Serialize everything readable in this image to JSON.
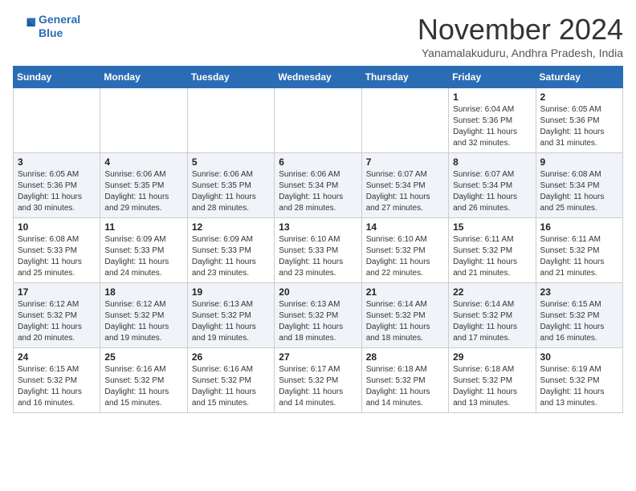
{
  "header": {
    "logo_line1": "General",
    "logo_line2": "Blue",
    "month_title": "November 2024",
    "location": "Yanamalakuduru, Andhra Pradesh, India"
  },
  "weekdays": [
    "Sunday",
    "Monday",
    "Tuesday",
    "Wednesday",
    "Thursday",
    "Friday",
    "Saturday"
  ],
  "weeks": [
    [
      {
        "day": "",
        "info": ""
      },
      {
        "day": "",
        "info": ""
      },
      {
        "day": "",
        "info": ""
      },
      {
        "day": "",
        "info": ""
      },
      {
        "day": "",
        "info": ""
      },
      {
        "day": "1",
        "info": "Sunrise: 6:04 AM\nSunset: 5:36 PM\nDaylight: 11 hours and 32 minutes."
      },
      {
        "day": "2",
        "info": "Sunrise: 6:05 AM\nSunset: 5:36 PM\nDaylight: 11 hours and 31 minutes."
      }
    ],
    [
      {
        "day": "3",
        "info": "Sunrise: 6:05 AM\nSunset: 5:36 PM\nDaylight: 11 hours and 30 minutes."
      },
      {
        "day": "4",
        "info": "Sunrise: 6:06 AM\nSunset: 5:35 PM\nDaylight: 11 hours and 29 minutes."
      },
      {
        "day": "5",
        "info": "Sunrise: 6:06 AM\nSunset: 5:35 PM\nDaylight: 11 hours and 28 minutes."
      },
      {
        "day": "6",
        "info": "Sunrise: 6:06 AM\nSunset: 5:34 PM\nDaylight: 11 hours and 28 minutes."
      },
      {
        "day": "7",
        "info": "Sunrise: 6:07 AM\nSunset: 5:34 PM\nDaylight: 11 hours and 27 minutes."
      },
      {
        "day": "8",
        "info": "Sunrise: 6:07 AM\nSunset: 5:34 PM\nDaylight: 11 hours and 26 minutes."
      },
      {
        "day": "9",
        "info": "Sunrise: 6:08 AM\nSunset: 5:34 PM\nDaylight: 11 hours and 25 minutes."
      }
    ],
    [
      {
        "day": "10",
        "info": "Sunrise: 6:08 AM\nSunset: 5:33 PM\nDaylight: 11 hours and 25 minutes."
      },
      {
        "day": "11",
        "info": "Sunrise: 6:09 AM\nSunset: 5:33 PM\nDaylight: 11 hours and 24 minutes."
      },
      {
        "day": "12",
        "info": "Sunrise: 6:09 AM\nSunset: 5:33 PM\nDaylight: 11 hours and 23 minutes."
      },
      {
        "day": "13",
        "info": "Sunrise: 6:10 AM\nSunset: 5:33 PM\nDaylight: 11 hours and 23 minutes."
      },
      {
        "day": "14",
        "info": "Sunrise: 6:10 AM\nSunset: 5:32 PM\nDaylight: 11 hours and 22 minutes."
      },
      {
        "day": "15",
        "info": "Sunrise: 6:11 AM\nSunset: 5:32 PM\nDaylight: 11 hours and 21 minutes."
      },
      {
        "day": "16",
        "info": "Sunrise: 6:11 AM\nSunset: 5:32 PM\nDaylight: 11 hours and 21 minutes."
      }
    ],
    [
      {
        "day": "17",
        "info": "Sunrise: 6:12 AM\nSunset: 5:32 PM\nDaylight: 11 hours and 20 minutes."
      },
      {
        "day": "18",
        "info": "Sunrise: 6:12 AM\nSunset: 5:32 PM\nDaylight: 11 hours and 19 minutes."
      },
      {
        "day": "19",
        "info": "Sunrise: 6:13 AM\nSunset: 5:32 PM\nDaylight: 11 hours and 19 minutes."
      },
      {
        "day": "20",
        "info": "Sunrise: 6:13 AM\nSunset: 5:32 PM\nDaylight: 11 hours and 18 minutes."
      },
      {
        "day": "21",
        "info": "Sunrise: 6:14 AM\nSunset: 5:32 PM\nDaylight: 11 hours and 18 minutes."
      },
      {
        "day": "22",
        "info": "Sunrise: 6:14 AM\nSunset: 5:32 PM\nDaylight: 11 hours and 17 minutes."
      },
      {
        "day": "23",
        "info": "Sunrise: 6:15 AM\nSunset: 5:32 PM\nDaylight: 11 hours and 16 minutes."
      }
    ],
    [
      {
        "day": "24",
        "info": "Sunrise: 6:15 AM\nSunset: 5:32 PM\nDaylight: 11 hours and 16 minutes."
      },
      {
        "day": "25",
        "info": "Sunrise: 6:16 AM\nSunset: 5:32 PM\nDaylight: 11 hours and 15 minutes."
      },
      {
        "day": "26",
        "info": "Sunrise: 6:16 AM\nSunset: 5:32 PM\nDaylight: 11 hours and 15 minutes."
      },
      {
        "day": "27",
        "info": "Sunrise: 6:17 AM\nSunset: 5:32 PM\nDaylight: 11 hours and 14 minutes."
      },
      {
        "day": "28",
        "info": "Sunrise: 6:18 AM\nSunset: 5:32 PM\nDaylight: 11 hours and 14 minutes."
      },
      {
        "day": "29",
        "info": "Sunrise: 6:18 AM\nSunset: 5:32 PM\nDaylight: 11 hours and 13 minutes."
      },
      {
        "day": "30",
        "info": "Sunrise: 6:19 AM\nSunset: 5:32 PM\nDaylight: 11 hours and 13 minutes."
      }
    ]
  ]
}
